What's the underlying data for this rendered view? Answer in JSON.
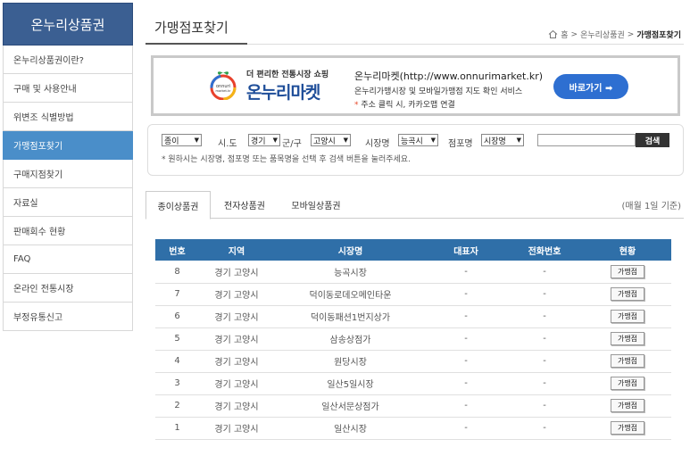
{
  "sidebar": {
    "title": "온누리상품권",
    "items": [
      {
        "label": "온누리상품권이란?"
      },
      {
        "label": "구매 및 사용안내"
      },
      {
        "label": "위변조 식별방법"
      },
      {
        "label": "가맹점포찾기",
        "active": true
      },
      {
        "label": "구매지점찾기"
      },
      {
        "label": "자료실"
      },
      {
        "label": "판매회수 현황"
      },
      {
        "label": "FAQ"
      },
      {
        "label": "온라인 전통시장"
      },
      {
        "label": "부정유통신고"
      }
    ]
  },
  "header": {
    "title": "가맹점포찾기",
    "breadcrumb": {
      "home": "홈",
      "section": "온누리상품권",
      "current": "가맹점포찾기"
    }
  },
  "banner": {
    "tagline": "더 편리한 전통시장 쇼핑",
    "brand": "온누리마켓",
    "logo_text": "onnuri market.kr",
    "url_line": "온누리마켓(http://www.onnurimarket.kr)",
    "desc": "온누리가맹시장 및 모바일가맹점 지도 확인 서비스",
    "note": "주소 클릭 시, 카카오맵 연결",
    "button": "바로가기 ➡"
  },
  "search": {
    "type_value": "종이",
    "sido_label": "시.도",
    "sido_value": "경기",
    "gugun_label": "군/구",
    "gugun_value": "고양시",
    "market_label": "시장명",
    "market_value": "능곡시",
    "store_label": "점포명",
    "store_value": "시장명",
    "input_value": "",
    "button": "검색",
    "hint": "* 원하시는 시장명, 점포명 또는 품목명을 선택 후 검색 버튼을 눌러주세요."
  },
  "tabs": [
    {
      "label": "종이상품권",
      "active": true
    },
    {
      "label": "전자상품권"
    },
    {
      "label": "모바일상품권"
    }
  ],
  "tab_note": "(매월 1일 기준)",
  "table": {
    "headers": [
      "번호",
      "지역",
      "시장명",
      "대표자",
      "전화번호",
      "현황"
    ],
    "rows": [
      {
        "no": "8",
        "region": "경기 고양시",
        "market": "능곡시장",
        "rep": "-",
        "tel": "-",
        "btn": "가맹점"
      },
      {
        "no": "7",
        "region": "경기 고양시",
        "market": "덕이동로데오메인타운",
        "rep": "-",
        "tel": "-",
        "btn": "가맹점"
      },
      {
        "no": "6",
        "region": "경기 고양시",
        "market": "덕이동패션1번지상가",
        "rep": "-",
        "tel": "-",
        "btn": "가맹점"
      },
      {
        "no": "5",
        "region": "경기 고양시",
        "market": "삼송상점가",
        "rep": "-",
        "tel": "-",
        "btn": "가맹점"
      },
      {
        "no": "4",
        "region": "경기 고양시",
        "market": "원당시장",
        "rep": "-",
        "tel": "-",
        "btn": "가맹점"
      },
      {
        "no": "3",
        "region": "경기 고양시",
        "market": "일산5일시장",
        "rep": "-",
        "tel": "-",
        "btn": "가맹점"
      },
      {
        "no": "2",
        "region": "경기 고양시",
        "market": "일산서문상점가",
        "rep": "-",
        "tel": "-",
        "btn": "가맹점"
      },
      {
        "no": "1",
        "region": "경기 고양시",
        "market": "일산시장",
        "rep": "-",
        "tel": "-",
        "btn": "가맹점"
      }
    ]
  }
}
